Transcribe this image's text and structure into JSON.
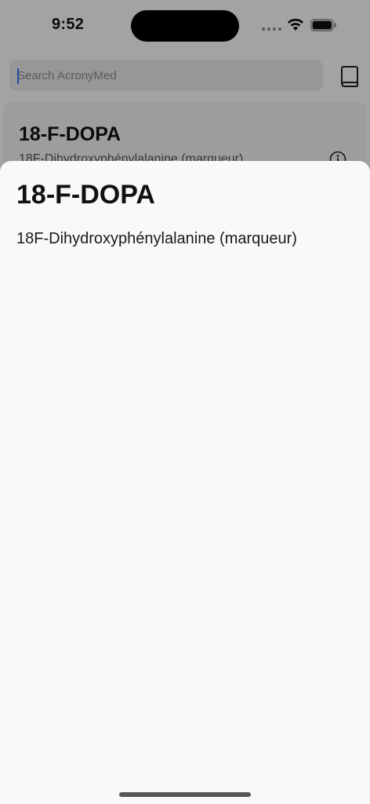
{
  "status": {
    "time": "9:52",
    "icons": [
      "cellular-signal-icon",
      "wifi-icon",
      "battery-icon"
    ]
  },
  "search": {
    "placeholder": "Search AcronyMed",
    "value": ""
  },
  "header": {
    "book_icon": "book-icon"
  },
  "list": {
    "items": [
      {
        "acronym": "18-F-DOPA",
        "definition": "18F-Dihydroxyphénylalanine (marqueur)",
        "icon": "info-icon"
      }
    ]
  },
  "sheet": {
    "title": "18-F-DOPA",
    "definition": "18F-Dihydroxyphénylalanine (marqueur)"
  },
  "colors": {
    "accent": "#3478f6",
    "sheet_background": "#f9f9f9",
    "dim_overlay": "rgba(0,0,0,0.36)"
  }
}
